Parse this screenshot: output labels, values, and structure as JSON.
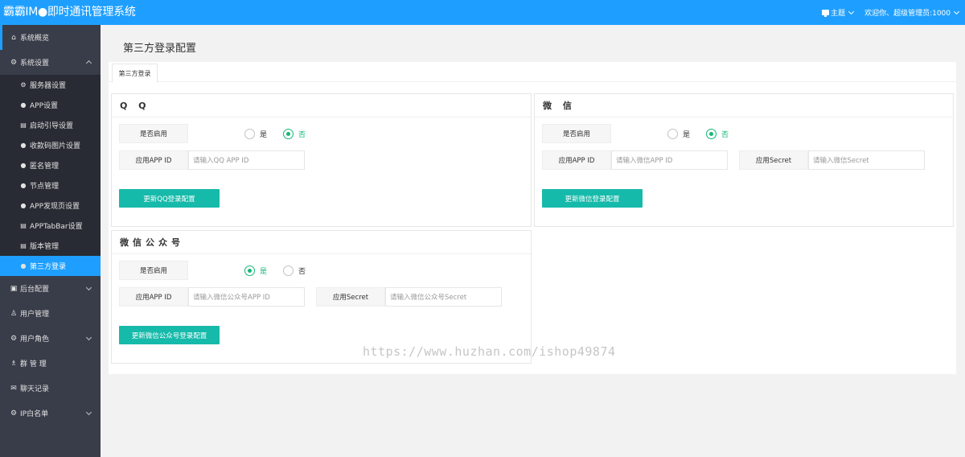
{
  "header": {
    "title": "霸霸IM●即时通讯管理系统",
    "theme_label": "主题",
    "user_label": "欢迎你、超级管理员:1000"
  },
  "sidebar": {
    "items": [
      {
        "label": "系统概览",
        "icon": "home-icon"
      },
      {
        "label": "系统设置",
        "icon": "gear-icon"
      },
      {
        "label": "后台配置",
        "icon": "config-icon"
      },
      {
        "label": "用户管理",
        "icon": "user-icon"
      },
      {
        "label": "用户角色",
        "icon": "gear-icon"
      },
      {
        "label": "群 管 理",
        "icon": "group-icon"
      },
      {
        "label": "聊天记录",
        "icon": "chat-icon"
      },
      {
        "label": "IP白名单",
        "icon": "gear-icon"
      }
    ],
    "sub_items": [
      {
        "label": "服务器设置"
      },
      {
        "label": "APP设置"
      },
      {
        "label": "启动引导设置"
      },
      {
        "label": "收款码图片设置"
      },
      {
        "label": "匿名管理"
      },
      {
        "label": "节点管理"
      },
      {
        "label": "APP发现页设置"
      },
      {
        "label": "APPTabBar设置"
      },
      {
        "label": "版本管理"
      },
      {
        "label": "第三方登录"
      }
    ]
  },
  "page": {
    "title": "第三方登录配置",
    "tab": "第三方登录"
  },
  "qq": {
    "title": "Q Q",
    "enable_label": "是否启用",
    "yes": "是",
    "no": "否",
    "enabled": false,
    "app_id_label": "应用APP ID",
    "app_id_placeholder": "请输入QQ APP ID",
    "button": "更新QQ登录配置"
  },
  "wechat": {
    "title": "微 信",
    "enable_label": "是否启用",
    "yes": "是",
    "no": "否",
    "enabled": false,
    "app_id_label": "应用APP ID",
    "app_id_placeholder": "请输入微信APP ID",
    "secret_label": "应用Secret",
    "secret_placeholder": "请输入微信Secret",
    "button": "更新微信登录配置"
  },
  "wechat_mp": {
    "title": "微信公众号",
    "enable_label": "是否启用",
    "yes": "是",
    "no": "否",
    "enabled": true,
    "app_id_label": "应用APP ID",
    "app_id_placeholder": "请输入微信公众号APP ID",
    "secret_label": "应用Secret",
    "secret_placeholder": "请输入微信公众号Secret",
    "button": "更新微信公众号登录配置"
  },
  "watermark": "https://www.huzhan.com/ishop49874",
  "colors": {
    "header": "#1e9fff",
    "sidebar": "#393d49",
    "active": "#1e9fff",
    "button": "#16baaa",
    "radio_on": "#16b777"
  }
}
